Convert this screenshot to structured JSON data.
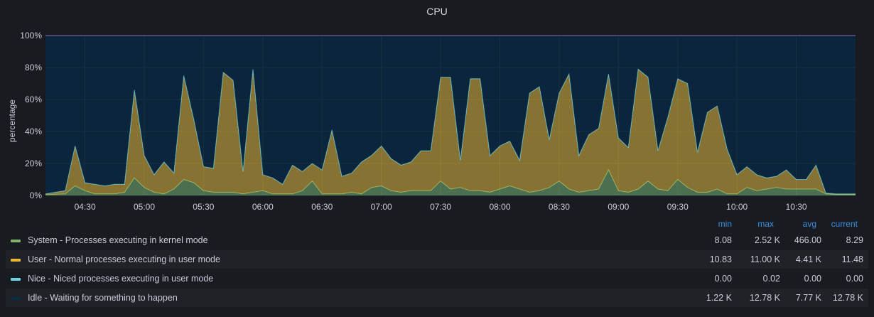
{
  "panel": {
    "title": "CPU"
  },
  "chart_data": {
    "type": "area",
    "stacked": true,
    "title": "CPU",
    "xlabel": "",
    "ylabel": "percentage",
    "ylim": [
      0,
      100
    ],
    "y_ticks": [
      "0%",
      "20%",
      "40%",
      "60%",
      "80%",
      "100%"
    ],
    "x_ticks": [
      "04:30",
      "05:00",
      "05:30",
      "06:00",
      "06:30",
      "07:00",
      "07:30",
      "08:00",
      "08:30",
      "09:00",
      "09:30",
      "10:00",
      "10:30"
    ],
    "x_minutes": [
      250,
      260,
      265,
      270,
      275,
      280,
      285,
      290,
      295,
      300,
      305,
      310,
      315,
      320,
      325,
      330,
      335,
      340,
      345,
      350,
      355,
      360,
      365,
      370,
      375,
      380,
      385,
      390,
      395,
      400,
      405,
      410,
      415,
      420,
      425,
      430,
      435,
      440,
      445,
      450,
      455,
      460,
      465,
      470,
      475,
      480,
      485,
      490,
      495,
      500,
      505,
      510,
      515,
      520,
      525,
      530,
      535,
      540,
      545,
      550,
      555,
      560,
      565,
      570,
      575,
      580,
      585,
      590,
      595,
      600,
      605,
      610,
      615,
      620,
      625,
      630,
      635,
      640,
      645,
      650,
      655,
      660
    ],
    "grid": true,
    "legend_position": "bottom",
    "series": [
      {
        "name": "System - Processes executing in kernel mode",
        "color": "#7eb26d",
        "values": [
          0.5,
          1,
          6,
          3,
          1,
          1,
          1,
          2,
          11,
          5,
          2,
          1,
          4,
          10,
          8,
          3,
          2,
          2,
          2,
          1,
          2,
          3,
          1,
          1,
          1,
          3,
          9,
          1,
          1,
          1,
          2,
          1,
          5,
          6,
          3,
          2,
          3,
          3,
          3,
          9,
          4,
          5,
          3,
          3,
          2,
          4,
          6,
          4,
          2,
          3,
          5,
          9,
          4,
          2,
          3,
          4,
          16,
          3,
          2,
          4,
          9,
          4,
          3,
          10,
          5,
          2,
          2,
          4,
          1,
          1,
          5,
          3,
          4,
          5,
          4,
          4,
          4,
          4,
          1,
          0.5,
          0.5,
          0.5
        ]
      },
      {
        "name": "User - Normal processes executing in user mode",
        "color": "#eab839",
        "values": [
          0.5,
          2,
          25,
          5,
          6,
          5,
          6,
          5,
          55,
          20,
          11,
          20,
          10,
          65,
          40,
          15,
          15,
          75,
          70,
          14,
          77,
          10,
          10,
          6,
          18,
          12,
          11,
          15,
          40,
          11,
          12,
          20,
          20,
          25,
          20,
          17,
          18,
          25,
          25,
          65,
          70,
          17,
          70,
          70,
          23,
          27,
          28,
          18,
          62,
          65,
          30,
          55,
          72,
          23,
          35,
          38,
          60,
          33,
          28,
          75,
          65,
          24,
          46,
          63,
          65,
          25,
          50,
          52,
          28,
          12,
          13,
          10,
          7,
          7,
          12,
          6,
          6,
          15,
          0.5,
          0.5,
          0.5,
          0.5
        ]
      },
      {
        "name": "Nice - Niced processes executing in user mode",
        "color": "#6ed0e0",
        "values": [
          0,
          0,
          0,
          0,
          0,
          0,
          0,
          0,
          0,
          0,
          0,
          0,
          0,
          0,
          0,
          0,
          0,
          0,
          0,
          0,
          0,
          0,
          0,
          0,
          0,
          0,
          0,
          0,
          0,
          0,
          0,
          0,
          0,
          0,
          0,
          0,
          0,
          0,
          0,
          0,
          0,
          0,
          0,
          0,
          0,
          0,
          0,
          0,
          0,
          0,
          0,
          0,
          0,
          0,
          0,
          0,
          0,
          0,
          0,
          0,
          0,
          0,
          0,
          0,
          0,
          0,
          0,
          0,
          0,
          0,
          0,
          0,
          0,
          0,
          0,
          0,
          0,
          0,
          0,
          0,
          0,
          0
        ]
      },
      {
        "name": "Idle - Waiting for something to happen",
        "color": "#0a2e48",
        "values": [
          99,
          97,
          69,
          92,
          93,
          94,
          93,
          93,
          34,
          75,
          87,
          79,
          86,
          25,
          52,
          82,
          83,
          23,
          28,
          85,
          21,
          87,
          89,
          93,
          81,
          85,
          80,
          84,
          59,
          88,
          86,
          79,
          75,
          69,
          77,
          81,
          79,
          72,
          72,
          26,
          26,
          78,
          27,
          27,
          75,
          69,
          66,
          78,
          36,
          32,
          65,
          36,
          24,
          75,
          62,
          58,
          24,
          64,
          70,
          21,
          26,
          72,
          51,
          27,
          30,
          73,
          48,
          44,
          71,
          87,
          82,
          87,
          89,
          88,
          84,
          90,
          90,
          81,
          98.5,
          99,
          99,
          99
        ]
      }
    ]
  },
  "legend": {
    "headers": [
      "min",
      "max",
      "avg",
      "current"
    ],
    "rows": [
      {
        "name": "System - Processes executing in kernel mode",
        "color": "#7eb26d",
        "min": "8.08",
        "max": "2.52 K",
        "avg": "466.00",
        "current": "8.29"
      },
      {
        "name": "User - Normal processes executing in user mode",
        "color": "#eab839",
        "min": "10.83",
        "max": "11.00 K",
        "avg": "4.41 K",
        "current": "11.48"
      },
      {
        "name": "Nice - Niced processes executing in user mode",
        "color": "#6ed0e0",
        "min": "0.00",
        "max": "0.02",
        "avg": "0.00",
        "current": "0.00"
      },
      {
        "name": "Idle - Waiting for something to happen",
        "color": "#0a2e48",
        "min": "1.22 K",
        "max": "12.78 K",
        "avg": "7.77 K",
        "current": "12.78 K"
      }
    ]
  },
  "colors": {
    "background": "#181b1f",
    "plot_background": "#0f1e2e",
    "grid": "#2c3235",
    "legend_header": "#3d8fe6",
    "top_line": "#806eb7"
  }
}
